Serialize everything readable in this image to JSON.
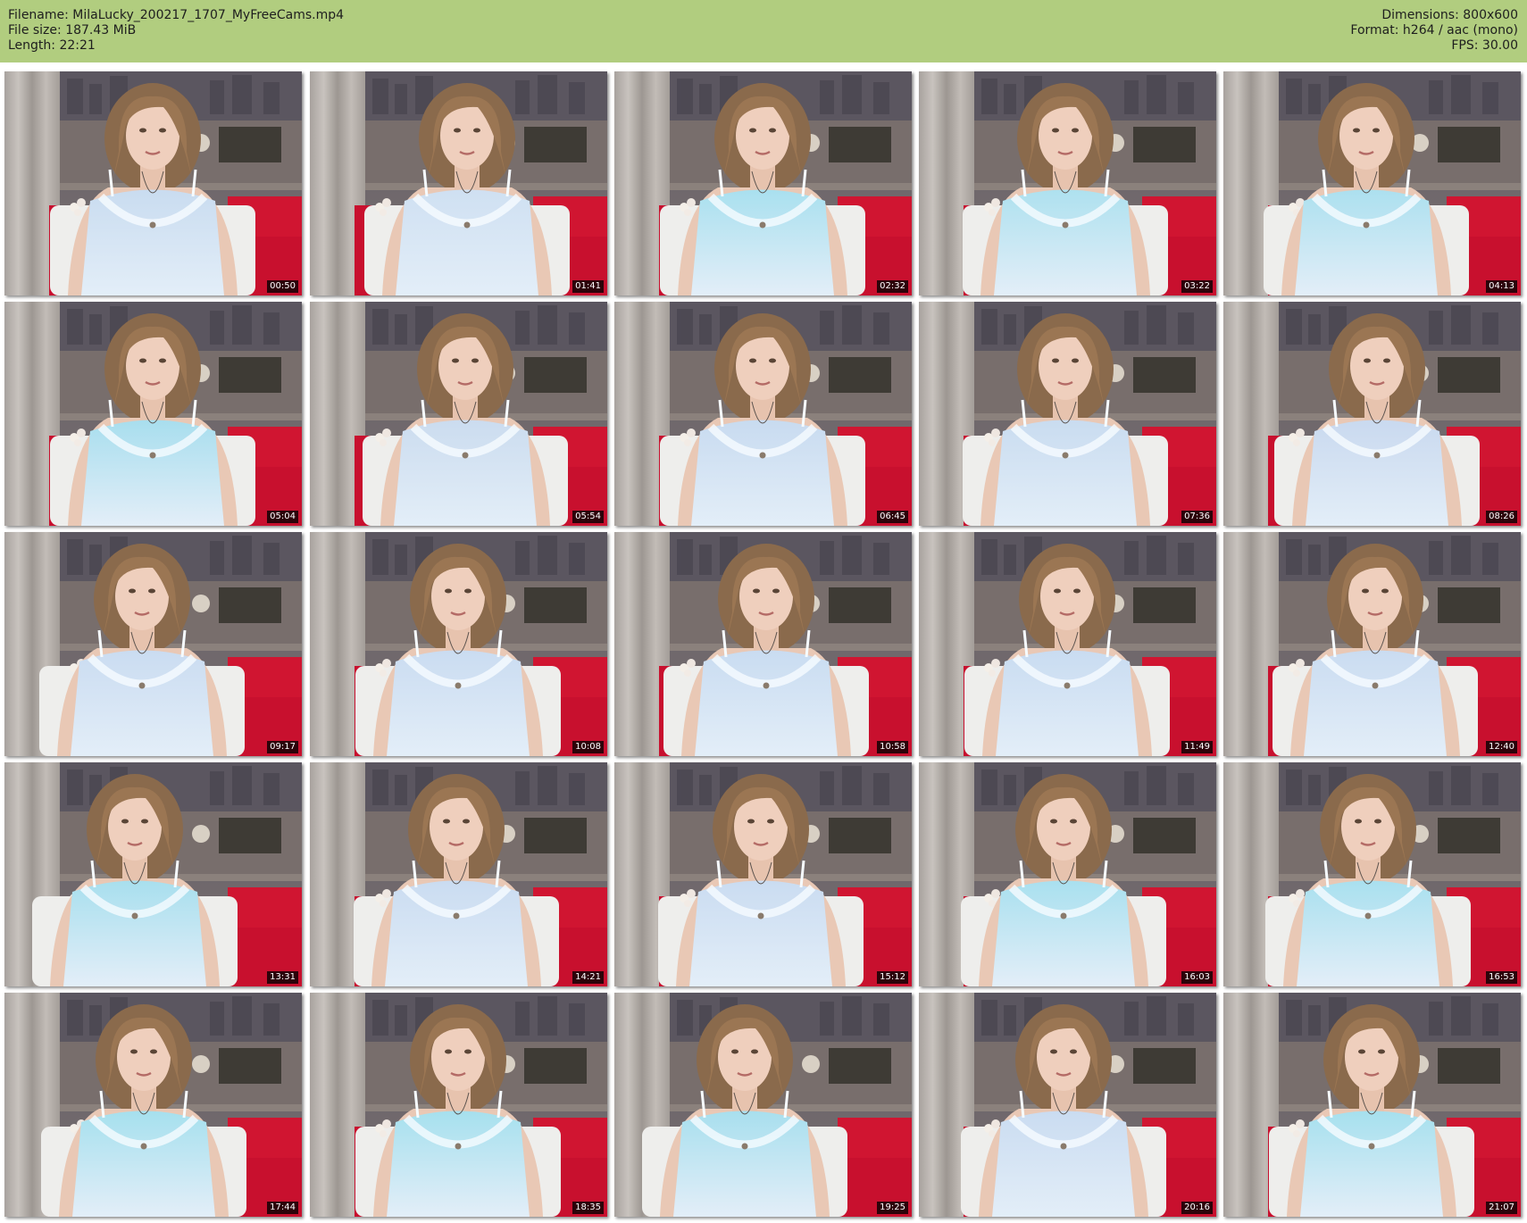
{
  "meta": {
    "filename": "Filename: MilaLucky_200217_1707_MyFreeCams.mp4",
    "filesize": "File size: 187.43 MiB",
    "length": "Length: 22:21",
    "dimensions": "Dimensions: 800x600",
    "format": "Format: h264 / aac (mono)",
    "fps": "FPS: 30.00"
  },
  "colors": {
    "header_bg": "#b1cd7f",
    "sofa": "#c8102e",
    "top": "#bfe3f0",
    "wall": "#6e6366"
  },
  "thumbnails": [
    {
      "time": "00:50",
      "top": "#c9dcf0"
    },
    {
      "time": "01:41",
      "top": "#cfe0f2"
    },
    {
      "time": "02:32",
      "top": "#a9e0ef"
    },
    {
      "time": "03:22",
      "top": "#aee1ef"
    },
    {
      "time": "04:13",
      "top": "#ace0ef"
    },
    {
      "time": "05:04",
      "top": "#a8deee"
    },
    {
      "time": "05:54",
      "top": "#cbdcef"
    },
    {
      "time": "06:45",
      "top": "#c8dbf0"
    },
    {
      "time": "07:36",
      "top": "#c9dcf0"
    },
    {
      "time": "08:26",
      "top": "#c9d9ef"
    },
    {
      "time": "09:17",
      "top": "#cadcf1"
    },
    {
      "time": "10:08",
      "top": "#cadcf1"
    },
    {
      "time": "10:58",
      "top": "#c9dcf1"
    },
    {
      "time": "11:49",
      "top": "#c9dcf1"
    },
    {
      "time": "12:40",
      "top": "#cadcf1"
    },
    {
      "time": "13:31",
      "top": "#a8dfee"
    },
    {
      "time": "14:21",
      "top": "#cadcf1"
    },
    {
      "time": "15:12",
      "top": "#cadcf1"
    },
    {
      "time": "16:03",
      "top": "#a9e0ef"
    },
    {
      "time": "16:53",
      "top": "#a9e0ef"
    },
    {
      "time": "17:44",
      "top": "#a6e0ee"
    },
    {
      "time": "18:35",
      "top": "#a6e0ee"
    },
    {
      "time": "19:25",
      "top": "#a8dfee"
    },
    {
      "time": "20:16",
      "top": "#cadcf1"
    },
    {
      "time": "21:07",
      "top": "#a6e0ee"
    }
  ]
}
